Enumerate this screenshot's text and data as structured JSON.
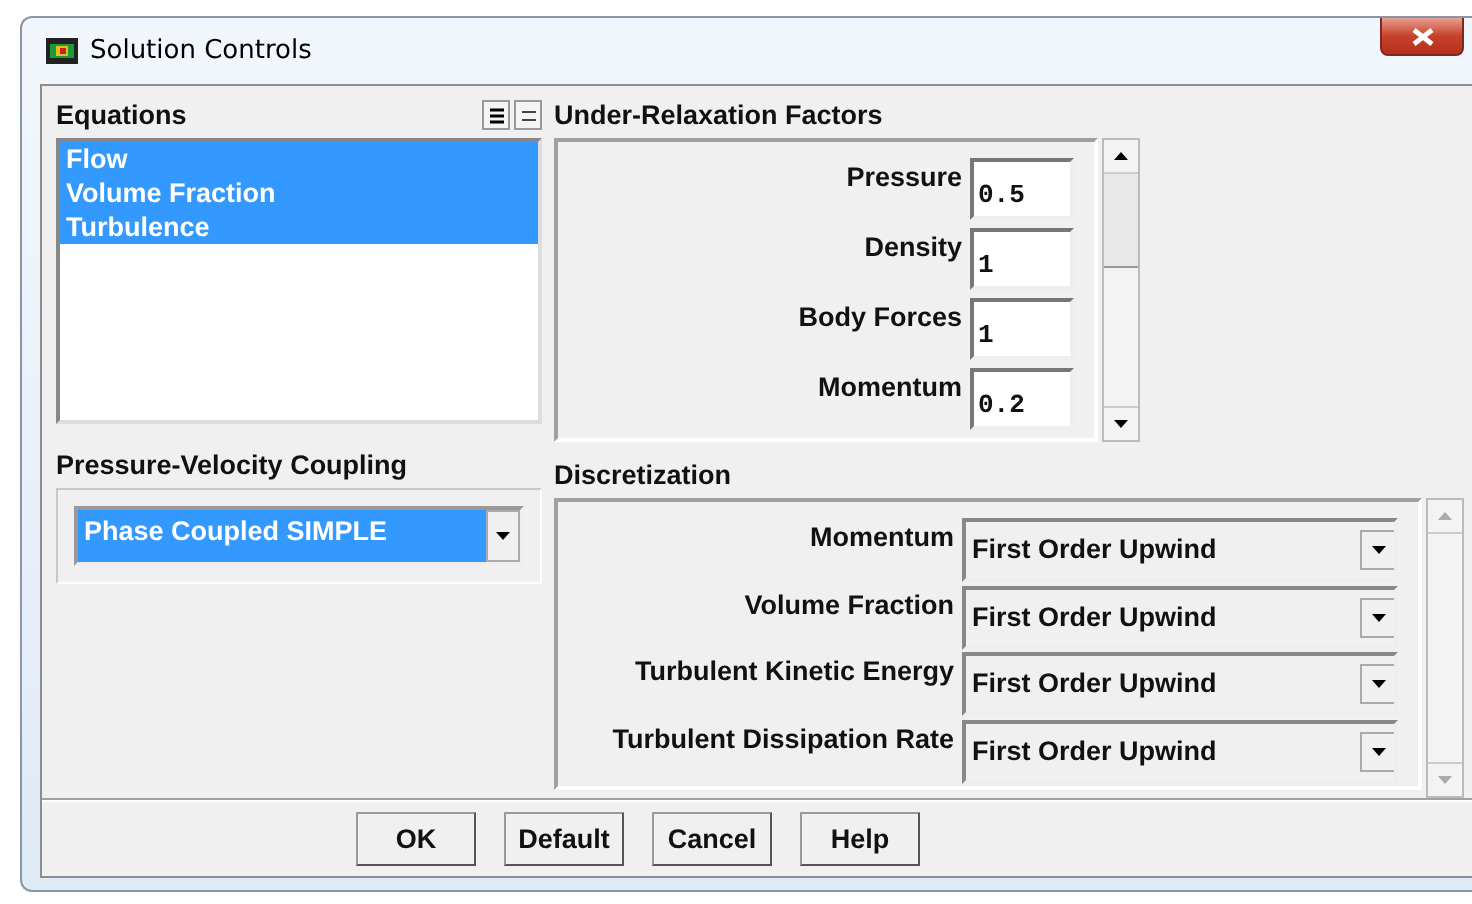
{
  "window": {
    "title": "Solution Controls"
  },
  "equations": {
    "label": "Equations",
    "items": [
      {
        "label": "Flow",
        "selected": true
      },
      {
        "label": "Volume Fraction",
        "selected": true
      },
      {
        "label": "Turbulence",
        "selected": true
      }
    ]
  },
  "pressure_velocity_coupling": {
    "label": "Pressure-Velocity Coupling",
    "value": "Phase Coupled SIMPLE"
  },
  "under_relaxation_factors": {
    "label": "Under-Relaxation Factors",
    "rows": [
      {
        "label": "Pressure",
        "value": "0.5"
      },
      {
        "label": "Density",
        "value": "1"
      },
      {
        "label": "Body Forces",
        "value": "1"
      },
      {
        "label": "Momentum",
        "value": "0.2"
      }
    ]
  },
  "discretization": {
    "label": "Discretization",
    "rows": [
      {
        "label": "Momentum",
        "value": "First Order Upwind"
      },
      {
        "label": "Volume Fraction",
        "value": "First Order Upwind"
      },
      {
        "label": "Turbulent Kinetic Energy",
        "value": "First Order Upwind"
      },
      {
        "label": "Turbulent Dissipation Rate",
        "value": "First Order Upwind"
      }
    ]
  },
  "buttons": [
    "OK",
    "Default",
    "Cancel",
    "Help"
  ]
}
